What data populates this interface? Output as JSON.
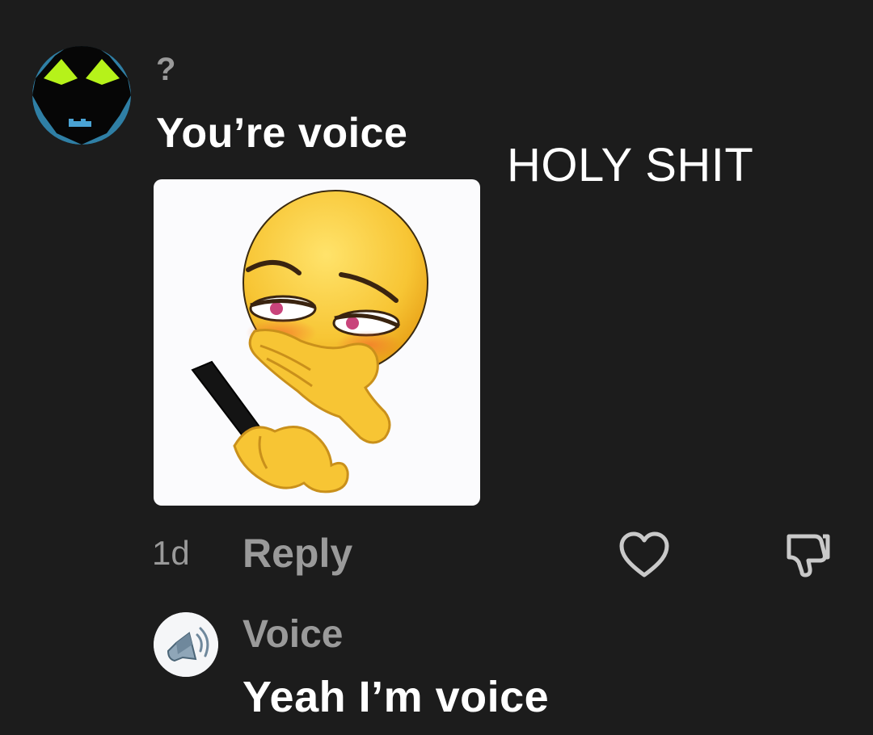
{
  "overlay_caption": "HOLY SHIT",
  "comments": [
    {
      "username": "?",
      "text": "You’re voice",
      "avatar_icon": "creature-avatar-icon",
      "attachment": "blushing-emoji-phone-sticker",
      "timestamp": "1d",
      "reply_label": "Reply",
      "like_icon": "heart-icon",
      "dislike_icon": "thumbs-down-icon"
    },
    {
      "username": "Voice",
      "text": "Yeah I’m voice",
      "avatar_icon": "speaker-icon"
    }
  ],
  "colors": {
    "background": "#1c1c1c",
    "primary_text": "#ffffff",
    "secondary_text": "#9a9a9a",
    "sticker_background": "#fbfbfd",
    "emoji_yellow": "#f7c534",
    "avatar_accent_green": "#b6f21a",
    "avatar_accent_blue": "#2f7fa5"
  }
}
